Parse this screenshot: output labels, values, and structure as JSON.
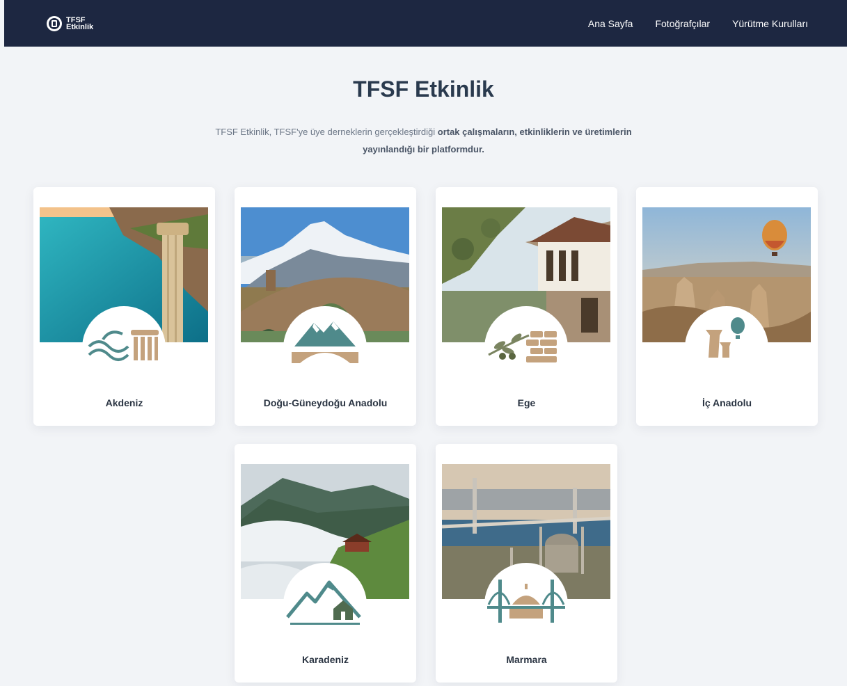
{
  "header": {
    "brand_line1": "TFSF",
    "brand_line2": "Etkinlik",
    "nav": [
      {
        "label": "Ana Sayfa"
      },
      {
        "label": "Fotoğrafçılar"
      },
      {
        "label": "Yürütme Kurulları"
      }
    ]
  },
  "main": {
    "title": "TFSF Etkinlik",
    "intro_start": "TFSF Etkinlik, TFSF'ye üye derneklerin gerçekleştirdiği",
    "intro_bold": "ortak çalışmaların, etkinliklerin ve üretimlerin yayınlandığı bir platformdur."
  },
  "regions": [
    {
      "name": "Akdeniz",
      "emblem": "waves-column-icon"
    },
    {
      "name": "Doğu-Güneydoğu Anadolu",
      "emblem": "mountain-bridge-icon"
    },
    {
      "name": "Ege",
      "emblem": "olive-stone-wall-icon"
    },
    {
      "name": "İç Anadolu",
      "emblem": "fairy-chimney-balloon-icon"
    },
    {
      "name": "Karadeniz",
      "emblem": "mountain-house-icon"
    },
    {
      "name": "Marmara",
      "emblem": "bridge-mosque-icon"
    }
  ],
  "colors": {
    "navbar": "#1d2741",
    "page_background": "#f2f4f7",
    "teal_accent": "#4f8a8b",
    "sand_accent": "#c4a27d",
    "olive_accent": "#7a8460"
  }
}
